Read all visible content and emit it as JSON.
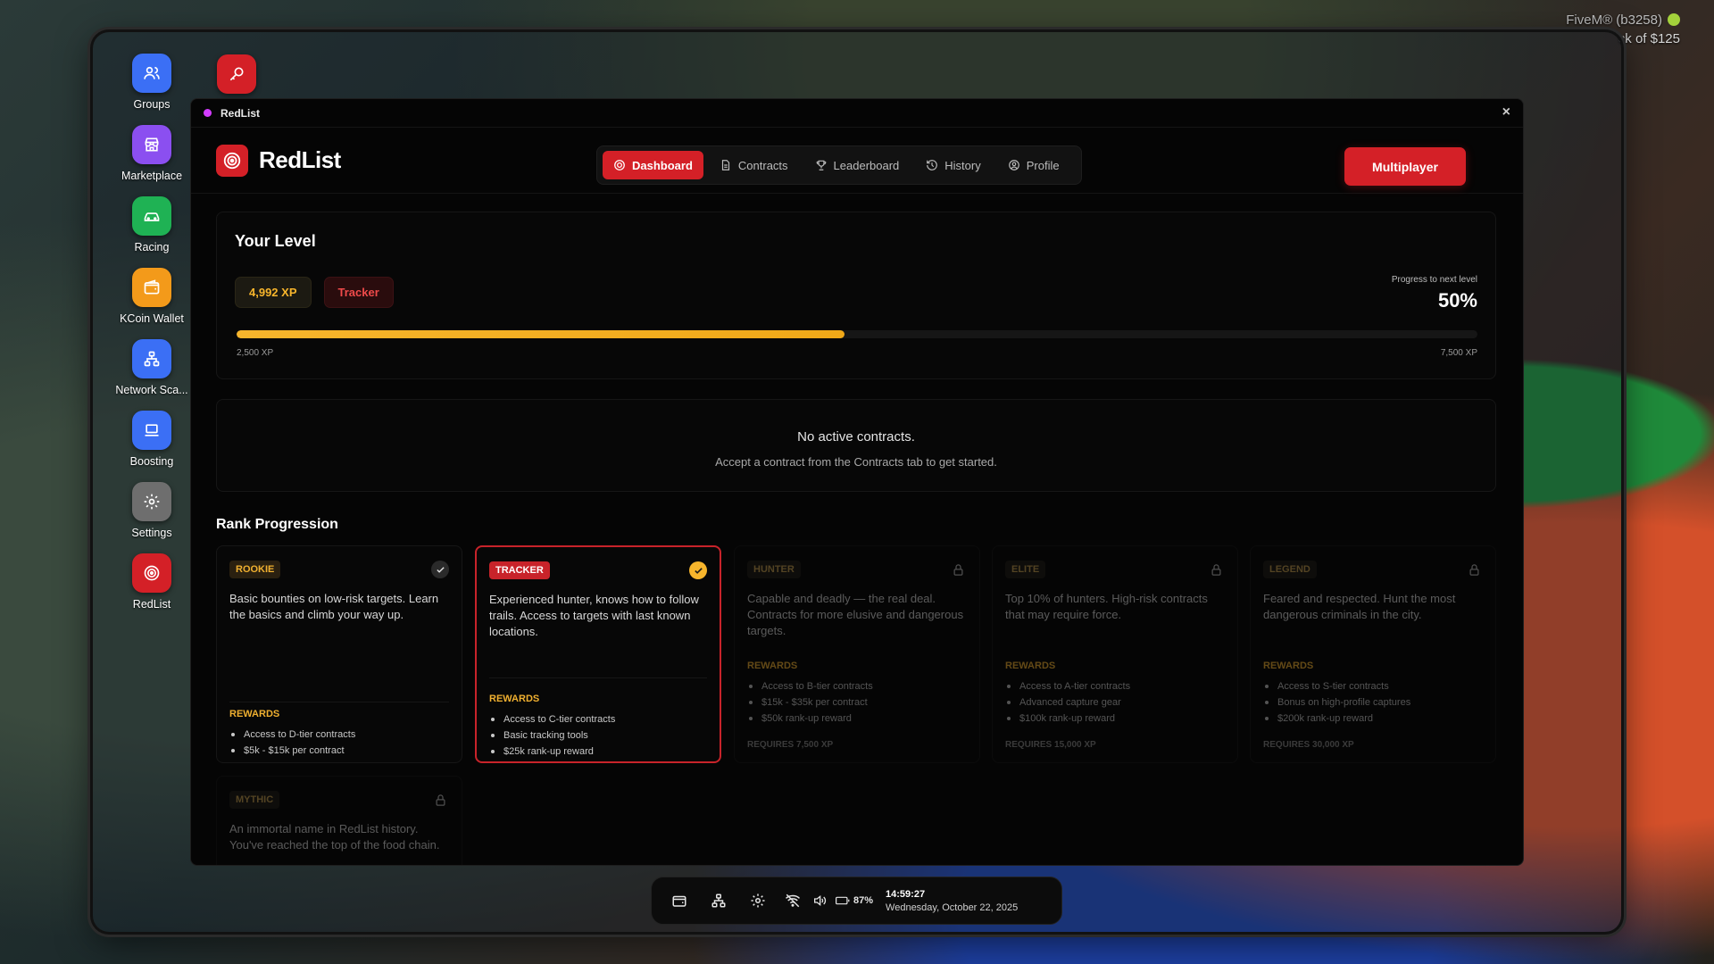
{
  "overlay": {
    "server": "FiveM® (b3258)",
    "notice": "ck of $125"
  },
  "desktop": {
    "apps": [
      {
        "label": "Groups",
        "color": "#3b6ff5"
      },
      {
        "label": "Marketplace",
        "color": "#8b4ff0"
      },
      {
        "label": "Racing",
        "color": "#1fb254"
      },
      {
        "label": "KCoin Wallet",
        "color": "#f39a1a"
      },
      {
        "label": "Network Sca...",
        "color": "#3b6ff5"
      },
      {
        "label": "Boosting",
        "color": "#3b6ff5"
      },
      {
        "label": "Settings",
        "color": "#6e6e6e"
      },
      {
        "label": "RedList",
        "color": "#d42027"
      }
    ]
  },
  "window": {
    "title": "RedList",
    "close_label": "×"
  },
  "app": {
    "brand": "RedList",
    "nav": [
      {
        "label": "Dashboard",
        "active": true
      },
      {
        "label": "Contracts",
        "active": false
      },
      {
        "label": "Leaderboard",
        "active": false
      },
      {
        "label": "History",
        "active": false
      },
      {
        "label": "Profile",
        "active": false
      }
    ],
    "multiplayer_label": "Multiplayer"
  },
  "level": {
    "title": "Your Level",
    "xp": "4,992 XP",
    "rank": "Tracker",
    "progress_label": "Progress to next level",
    "progress_text": "50%",
    "progress_fraction": 0.4896,
    "min_label": "2,500 XP",
    "max_label": "7,500 XP"
  },
  "contracts": {
    "empty_title": "No active contracts.",
    "empty_sub": "Accept a contract from the Contracts tab to get started."
  },
  "ranks": {
    "title": "Rank Progression",
    "rewards_heading": "REWARDS",
    "items": [
      {
        "name": "ROOKIE",
        "state": "done",
        "desc": "Basic bounties on low-risk targets. Learn the basics and climb your way up.",
        "rewards": [
          "Access to D-tier contracts",
          "$5k - $15k per contract"
        ],
        "requires": ""
      },
      {
        "name": "TRACKER",
        "state": "current",
        "desc": "Experienced hunter, knows how to follow trails. Access to targets with last known locations.",
        "rewards": [
          "Access to C-tier contracts",
          "Basic tracking tools",
          "$25k rank-up reward"
        ],
        "requires": ""
      },
      {
        "name": "HUNTER",
        "state": "locked",
        "desc": "Capable and deadly — the real deal. Contracts for more elusive and dangerous targets.",
        "rewards": [
          "Access to B-tier contracts",
          "$15k - $35k per contract",
          "$50k rank-up reward"
        ],
        "requires": "REQUIRES 7,500 XP"
      },
      {
        "name": "ELITE",
        "state": "locked",
        "desc": "Top 10% of hunters. High-risk contracts that may require force.",
        "rewards": [
          "Access to A-tier contracts",
          "Advanced capture gear",
          "$100k rank-up reward"
        ],
        "requires": "REQUIRES 15,000 XP"
      },
      {
        "name": "LEGEND",
        "state": "locked",
        "desc": "Feared and respected. Hunt the most dangerous criminals in the city.",
        "rewards": [
          "Access to S-tier contracts",
          "Bonus on high-profile captures",
          "$200k rank-up reward"
        ],
        "requires": "REQUIRES 30,000 XP"
      },
      {
        "name": "MYTHIC",
        "state": "locked",
        "desc": "An immortal name in RedList history. You've reached the top of the food chain.",
        "rewards": [],
        "requires": ""
      }
    ]
  },
  "taskbar": {
    "battery": "87%",
    "time": "14:59:27",
    "date": "Wednesday, October 22, 2025"
  }
}
